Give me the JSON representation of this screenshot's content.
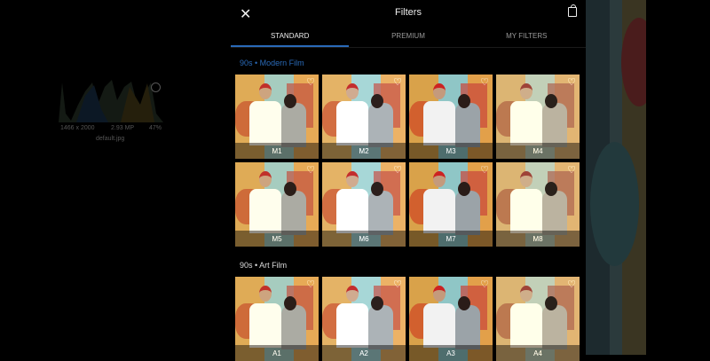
{
  "image_info": {
    "dimensions": "1466 x 2000",
    "megapixels": "2.93 MP",
    "zoom": "47%",
    "filename": "default.jpg"
  },
  "header": {
    "title": "Filters",
    "close_icon": "close-icon",
    "bag_icon": "shopping-bag-icon"
  },
  "tabs": [
    {
      "label": "STANDARD",
      "active": true
    },
    {
      "label": "PREMIUM"
    },
    {
      "label": "MY FILTERS"
    }
  ],
  "accent": "#2a6ab8",
  "sections": [
    {
      "title": "90s • Modern Film",
      "filters": [
        "M1",
        "M2",
        "M3",
        "M4",
        "M5",
        "M6",
        "M7",
        "M8"
      ]
    },
    {
      "title": "90s • Art Film",
      "filters": [
        "A1",
        "A2",
        "A3",
        "A4"
      ]
    }
  ]
}
